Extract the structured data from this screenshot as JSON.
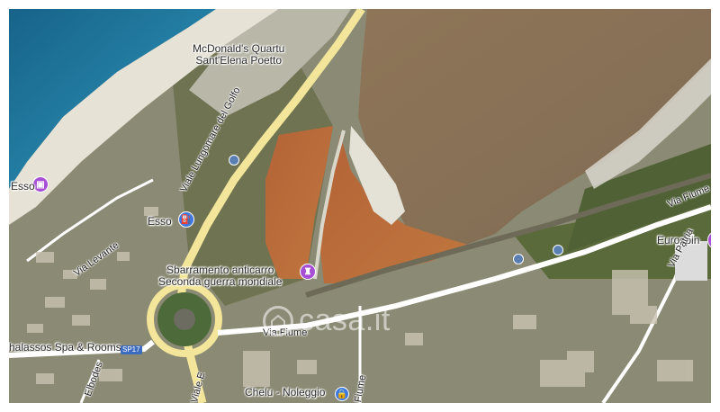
{
  "map": {
    "places": [
      {
        "id": "mcdonalds",
        "line1": "McDonald's Quartu",
        "line2": "Sant'Elena Poetto"
      },
      {
        "id": "esso-left",
        "text": "Esso"
      },
      {
        "id": "esso",
        "text": "Esso"
      },
      {
        "id": "sbarramento",
        "line1": "Sbarramento anticarro",
        "line2": "Seconda guerra mondiale"
      },
      {
        "id": "eurospin",
        "text": "Eurospin"
      },
      {
        "id": "thalassos",
        "text": "halassos Spa & Rooms"
      },
      {
        "id": "chelu",
        "text": "Chelu - Noleggio"
      }
    ],
    "roads": {
      "lungomare": "Viale Lungomare del Golfo",
      "levante": "Via Levante",
      "fiume_right": "Via Fiume",
      "fiume_center": "Via Fiume",
      "patria": "Via Patria",
      "elbodes": "Elbodes",
      "viale_e": "Viale E",
      "fiume_bottom": "Fiume"
    },
    "route_badge": "SP17",
    "watermark": "casa.it"
  },
  "colors": {
    "sea_deep": "#1f6f94",
    "sea_shallow": "#3fa3bd",
    "beach": "#e8e4d8",
    "lagoon_brown": "#8d7457",
    "salt_pond": "#b86a3a",
    "vegetation": "#5d6b3c",
    "road": "#f4e79a",
    "pin_purple": "#a64fd6",
    "pin_blue": "#3d77e0"
  },
  "icons": {
    "pin_shop": "shopping-bag-icon",
    "pin_fuel": "fuel-pump-icon",
    "pin_monument": "monument-icon",
    "pin_lock": "lock-icon",
    "transit": "bus-stop-icon",
    "watermark": "house-logo-icon"
  }
}
